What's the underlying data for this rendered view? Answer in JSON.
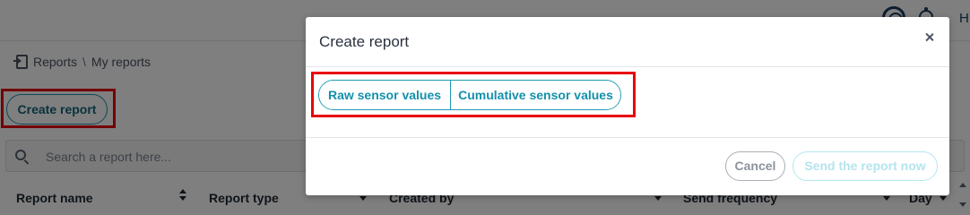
{
  "topbar": {
    "help_icon": "help-ring-icon",
    "notification_icon": "bell-icon",
    "user_initial": "H"
  },
  "breadcrumb": {
    "icon": "report-export-icon",
    "items": [
      "Reports",
      "My reports"
    ],
    "separator": "\\"
  },
  "toolbar": {
    "create_report_label": "Create report"
  },
  "search": {
    "placeholder": "Search a report here...",
    "value": ""
  },
  "table": {
    "columns": [
      "Report name",
      "Report type",
      "Created by",
      "Send frequency",
      "Day"
    ]
  },
  "modal": {
    "title": "Create report",
    "close_icon": "close-icon",
    "options": [
      "Raw sensor values",
      "Cumulative sensor values"
    ],
    "cancel_label": "Cancel",
    "send_label": "Send the report now"
  },
  "colors": {
    "accent": "#1e9ab2",
    "highlight": "#e8000c",
    "overlay": "rgba(0,0,0,0.5)"
  }
}
